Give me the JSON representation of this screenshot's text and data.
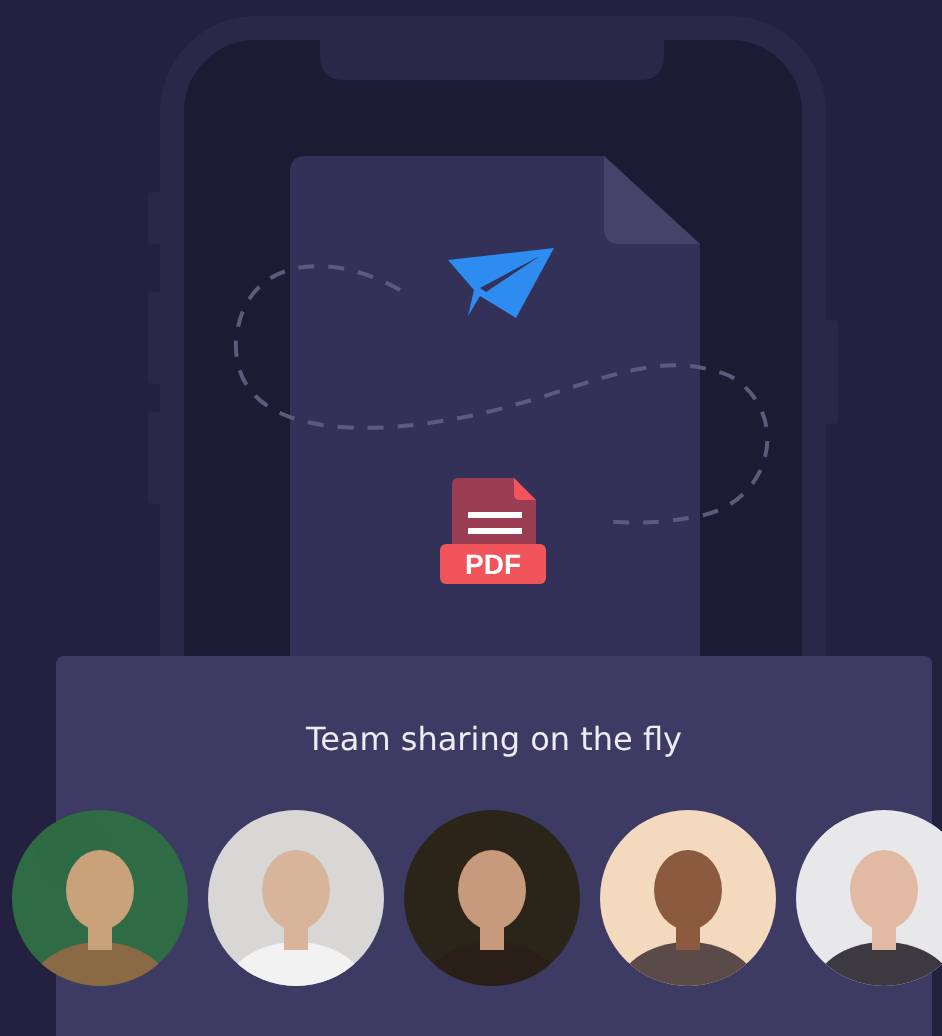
{
  "illustration": {
    "badge": "PDF"
  },
  "card": {
    "title": "Team sharing on the fly"
  }
}
